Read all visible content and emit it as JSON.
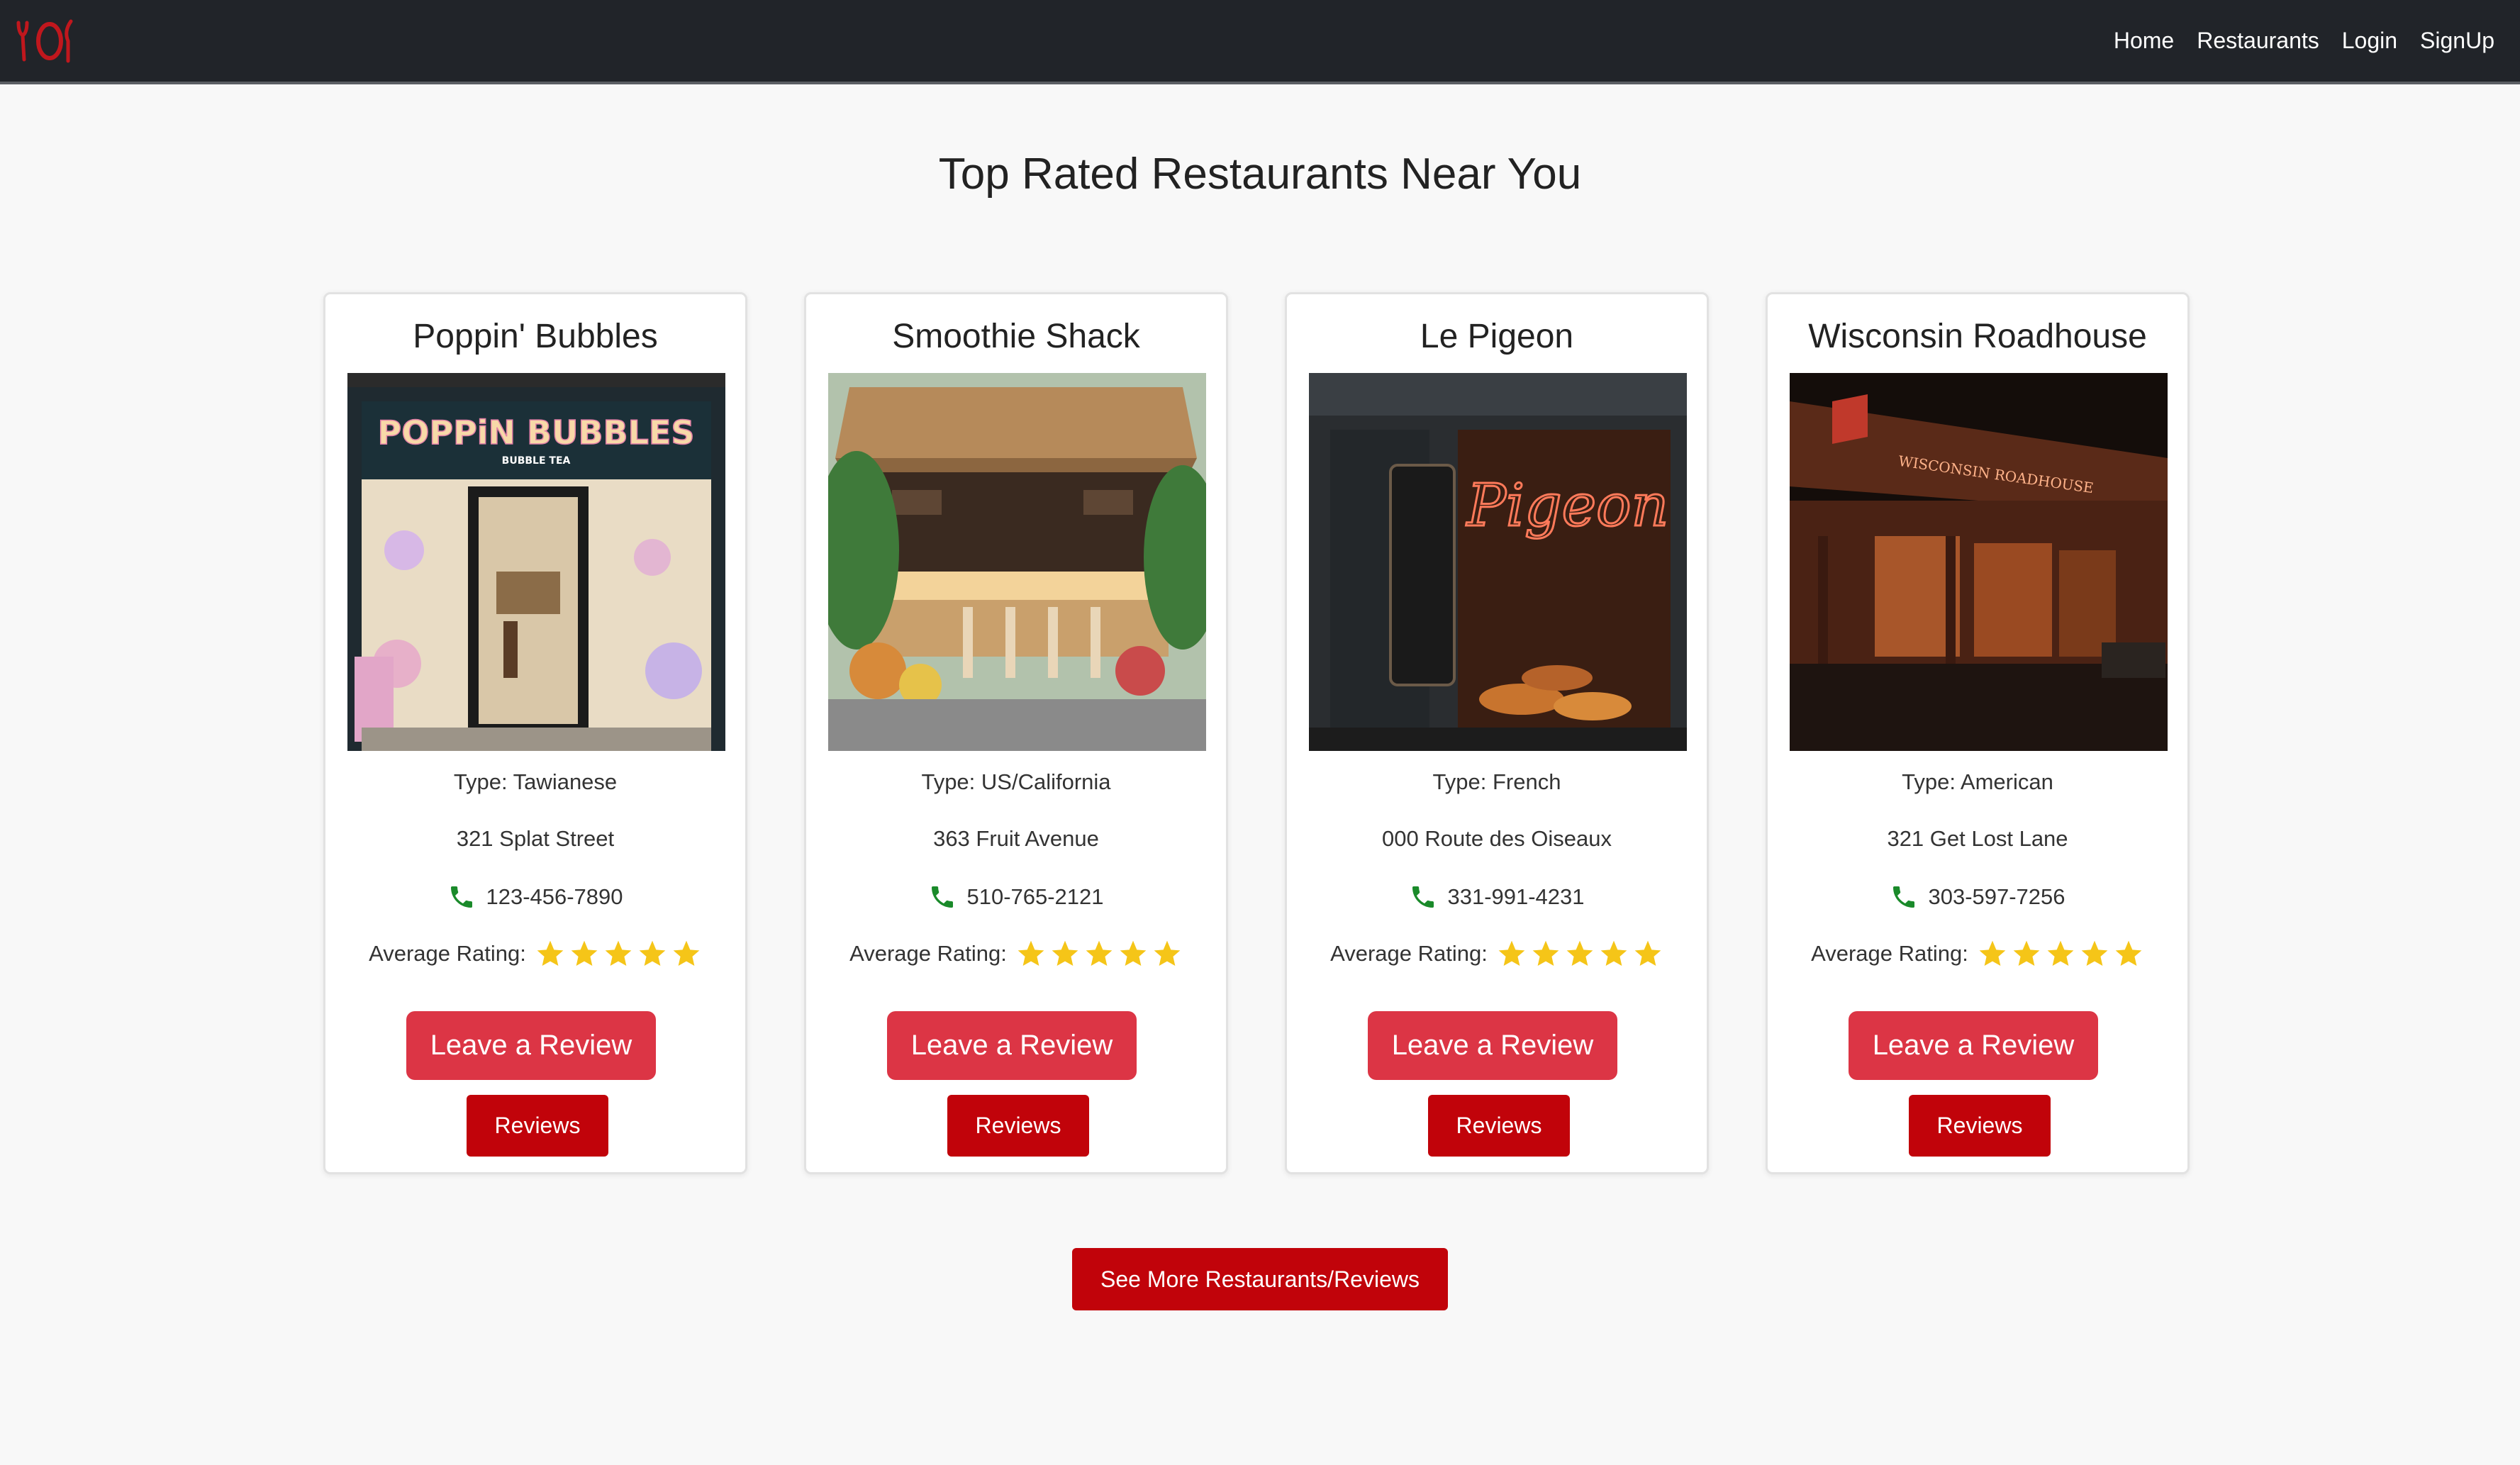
{
  "nav": {
    "links": [
      "Home",
      "Restaurants",
      "Login",
      "SignUp"
    ]
  },
  "page_title": "Top Rated Restaurants Near You",
  "rating_label": "Average Rating:",
  "buttons": {
    "leave_review": "Leave a Review",
    "reviews": "Reviews",
    "see_more": "See More Restaurants/Reviews"
  },
  "restaurants": [
    {
      "name": "Poppin' Bubbles",
      "type": "Type: Tawianese",
      "address": "321 Splat Street",
      "phone": "123-456-7890",
      "rating": 5
    },
    {
      "name": "Smoothie Shack",
      "type": "Type: US/California",
      "address": "363 Fruit Avenue",
      "phone": "510-765-2121",
      "rating": 5
    },
    {
      "name": "Le Pigeon",
      "type": "Type: French",
      "address": "000 Route des Oiseaux",
      "phone": "331-991-4231",
      "rating": 5
    },
    {
      "name": "Wisconsin Roadhouse",
      "type": "Type: American",
      "address": "321 Get Lost Lane",
      "phone": "303-597-7256",
      "rating": 5
    }
  ],
  "images": {
    "0": {
      "sign": "POPPiN BUBBLES",
      "subsign": "BUBBLE TEA"
    },
    "2": {
      "sign": "Pigeon"
    },
    "3": {
      "sign": "WISCONSIN ROADHOUSE"
    }
  },
  "colors": {
    "navbar": "#212429",
    "review_button": "#dc3545",
    "dark_button": "#c1030a",
    "star": "#f5c518",
    "phone_icon": "#1a8a2a"
  }
}
